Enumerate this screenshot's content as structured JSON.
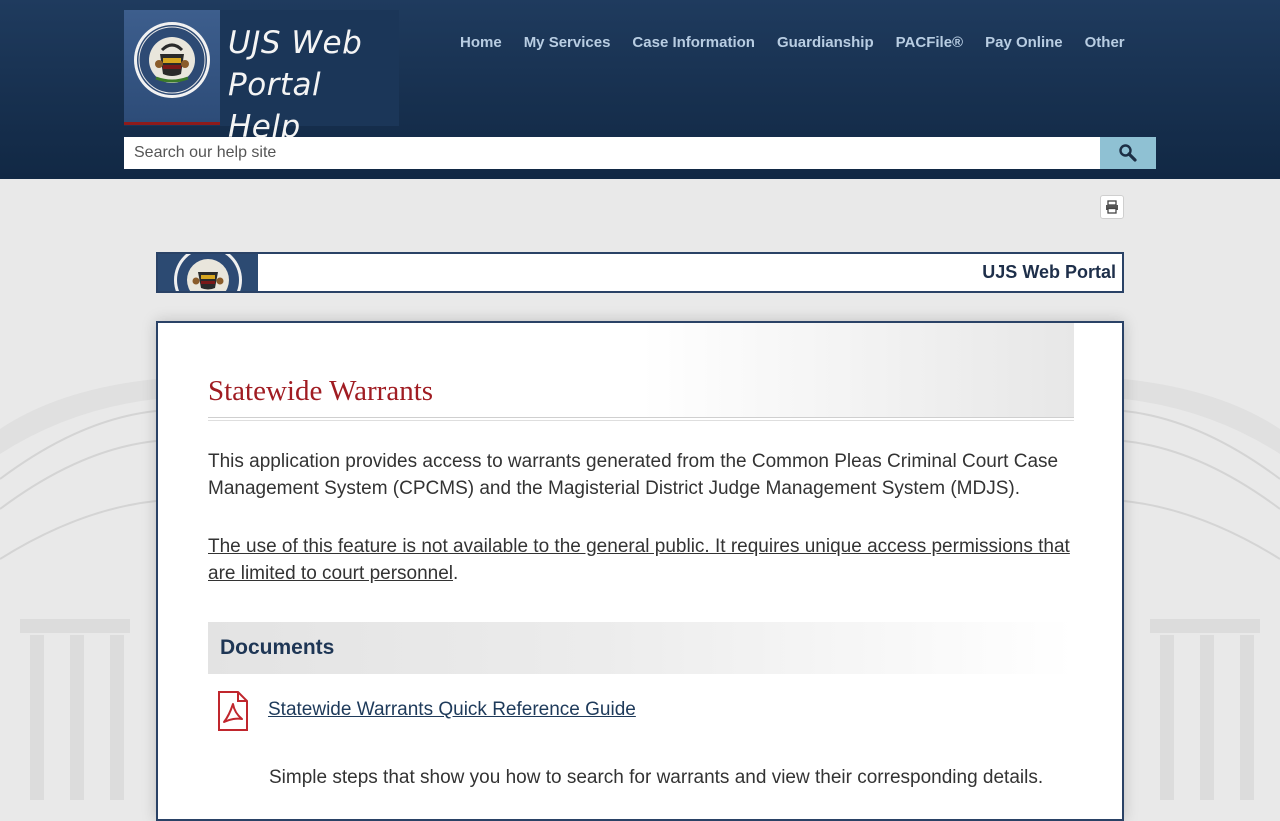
{
  "header": {
    "logo_title_line1": "UJS Web",
    "logo_title_line2": "Portal Help",
    "nav": [
      "Home",
      "My Services",
      "Case Information",
      "Guardianship",
      "PACFile®",
      "Pay Online",
      "Other"
    ],
    "search_placeholder": "Search our help site",
    "search_icon": "search-icon"
  },
  "toolbar": {
    "print_icon": "print-icon"
  },
  "banner": {
    "title": "UJS Web Portal"
  },
  "content": {
    "title": "Statewide Warrants",
    "intro": "This application provides access to warrants generated from the Common Pleas Criminal Court Case Management System (CPCMS) and the Magisterial District Judge Management System (MDJS).",
    "notice_link": "The use of this feature is not available to the general public. It requires unique access permissions that are limited to court personnel",
    "notice_suffix": ".",
    "documents_heading": "Documents",
    "documents": [
      {
        "icon": "pdf-icon",
        "link": "Statewide Warrants Quick Reference Guide",
        "description": "Simple steps that show you how to search for warrants and view their corresponding details."
      }
    ]
  },
  "colors": {
    "header_bg": "#17304f",
    "nav_text": "#b8cde2",
    "search_button": "#8fc1d3",
    "title_red": "#a01c22",
    "heading_navy": "#1e3655",
    "card_border": "#2a4266"
  }
}
